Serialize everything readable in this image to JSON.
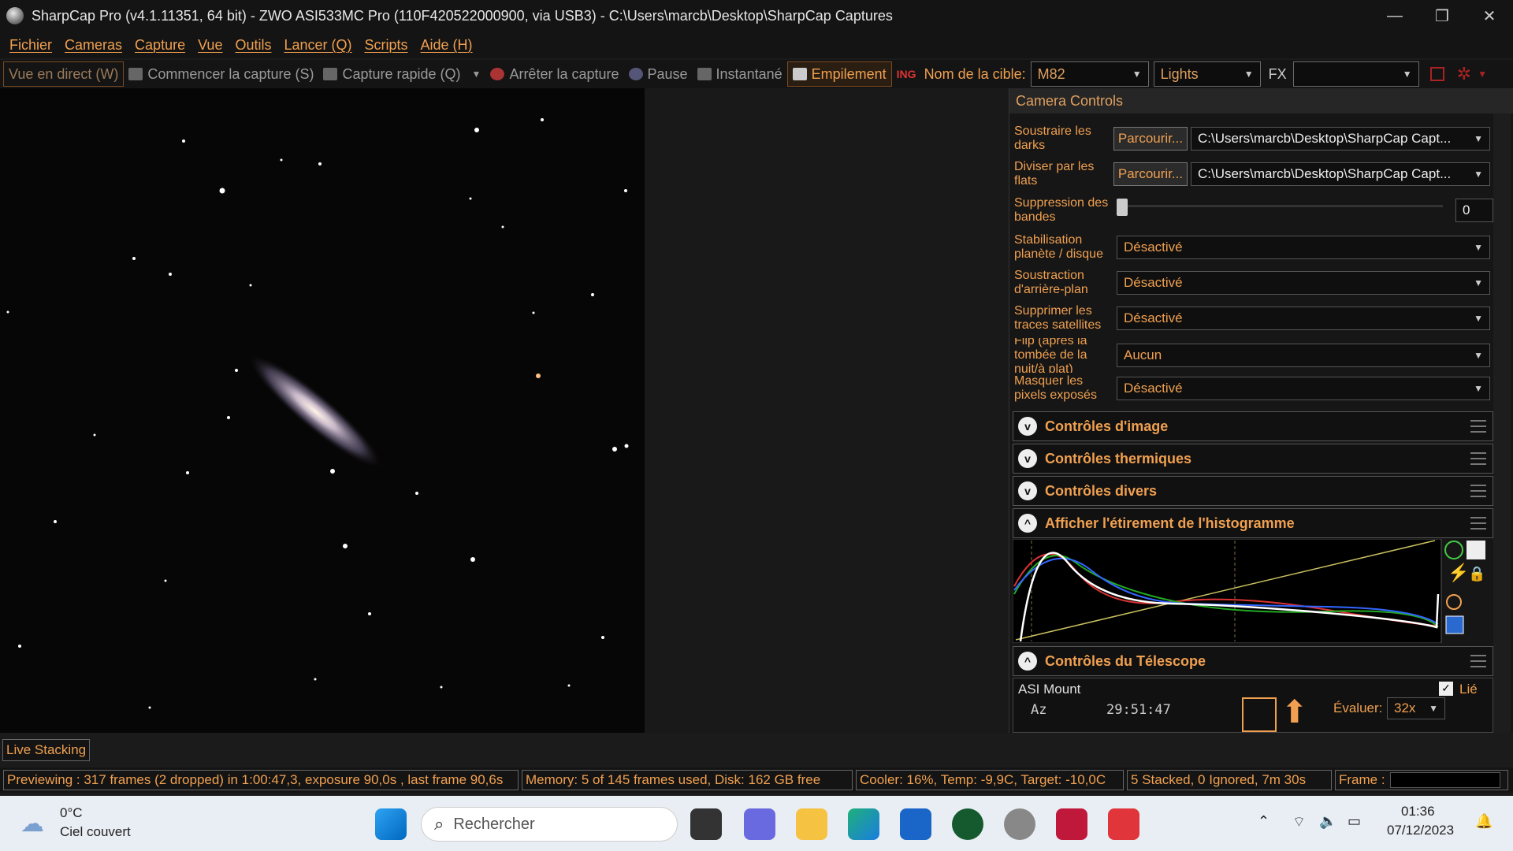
{
  "window": {
    "title": "SharpCap Pro (v4.1.11351, 64 bit) - ZWO ASI533MC Pro (110F420522000900, via USB3) - C:\\Users\\marcb\\Desktop\\SharpCap Captures",
    "minimize": "—",
    "restore": "❐",
    "close": "✕"
  },
  "menu": [
    "Fichier",
    "Cameras",
    "Capture",
    "Vue",
    "Outils",
    "Lancer (Q)",
    "Scripts",
    "Aide (H)"
  ],
  "toolbar": {
    "live_view": "Vue en direct (W)",
    "start_capture": "Commencer la capture (S)",
    "quick_capture": "Capture rapide (Q)",
    "stop_capture": "Arrêter la capture",
    "pause": "Pause",
    "snapshot": "Instantané",
    "stacking": "Empilement",
    "target_label": "Nom de la cible:",
    "target_value": "M82",
    "frame_type": "Lights",
    "fx_label": "FX",
    "fx_value": ""
  },
  "panel": {
    "title": "Camera Controls",
    "rows": [
      {
        "label": "Soustraire les darks",
        "button": "Parcourir...",
        "value": "C:\\Users\\marcb\\Desktop\\SharpCap Capt..."
      },
      {
        "label": "Diviser par les flats",
        "button": "Parcourir...",
        "value": "C:\\Users\\marcb\\Desktop\\SharpCap Capt..."
      }
    ],
    "banding": {
      "label": "Suppression des bandes",
      "value": "0"
    },
    "selects": [
      {
        "label": "Stabilisation planète / disque",
        "value": "Désactivé"
      },
      {
        "label": "Soustraction d'arrière-plan",
        "value": "Désactivé"
      },
      {
        "label": "Supprimer les traces satellites",
        "value": "Désactivé"
      },
      {
        "label": "Flip (après la tombée de la nuit/à plat)",
        "value": "Aucun"
      },
      {
        "label": "Masquer les pixels exposés",
        "value": "Désactivé"
      }
    ],
    "groups": {
      "image": "Contrôles d'image",
      "thermal": "Contrôles thermiques",
      "misc": "Contrôles divers",
      "histogram": "Afficher l'étirement de l'histogramme",
      "telescope": "Contrôles du Télescope"
    },
    "mount": {
      "name": "ASI Mount",
      "linked": "Lié",
      "az_label": "Az",
      "az_value": "29:51:47",
      "rate_label": "Évaluer:",
      "rate_value": "32x"
    }
  },
  "status": {
    "live_stacking": "Live Stacking",
    "preview": "Previewing : 317 frames (2 dropped) in 1:00:47,3, exposure 90,0s , last frame 90,6s",
    "memory": "Memory: 5 of 145 frames used, Disk: 162 GB free",
    "cooler": "Cooler: 16%, Temp: -9,9C, Target: -10,0C",
    "stacked": "5 Stacked, 0 Ignored, 7m 30s",
    "frame_label": "Frame :"
  },
  "taskbar": {
    "weather_temp": "0°C",
    "weather_desc": "Ciel couvert",
    "search_placeholder": "Rechercher",
    "time": "01:36",
    "date": "07/12/2023"
  },
  "colors": {
    "accent": "#f0a050",
    "background": "#141414"
  }
}
